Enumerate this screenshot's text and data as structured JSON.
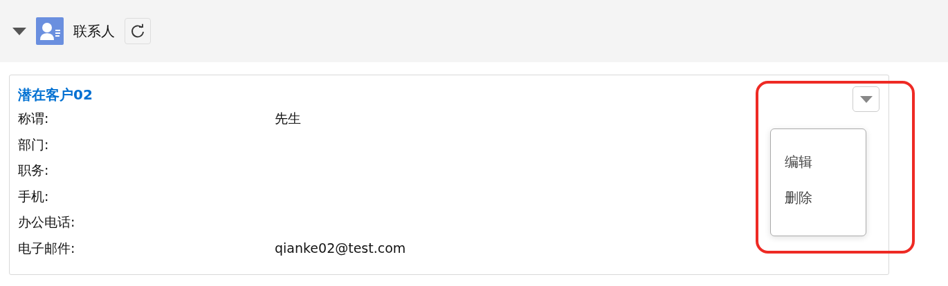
{
  "section": {
    "title": "联系人",
    "expanded": true
  },
  "contact": {
    "name": "潜在客户02",
    "fields": [
      {
        "label": "称谓:",
        "value": "先生"
      },
      {
        "label": "部门:"
      },
      {
        "label": "职务:"
      },
      {
        "label": "手机:"
      },
      {
        "label": "办公电话:"
      },
      {
        "label": "电子邮件:",
        "value": "qianke02@test.com"
      }
    ],
    "menu": {
      "open": true,
      "items": [
        "编辑",
        "删除"
      ]
    }
  },
  "highlight": true
}
